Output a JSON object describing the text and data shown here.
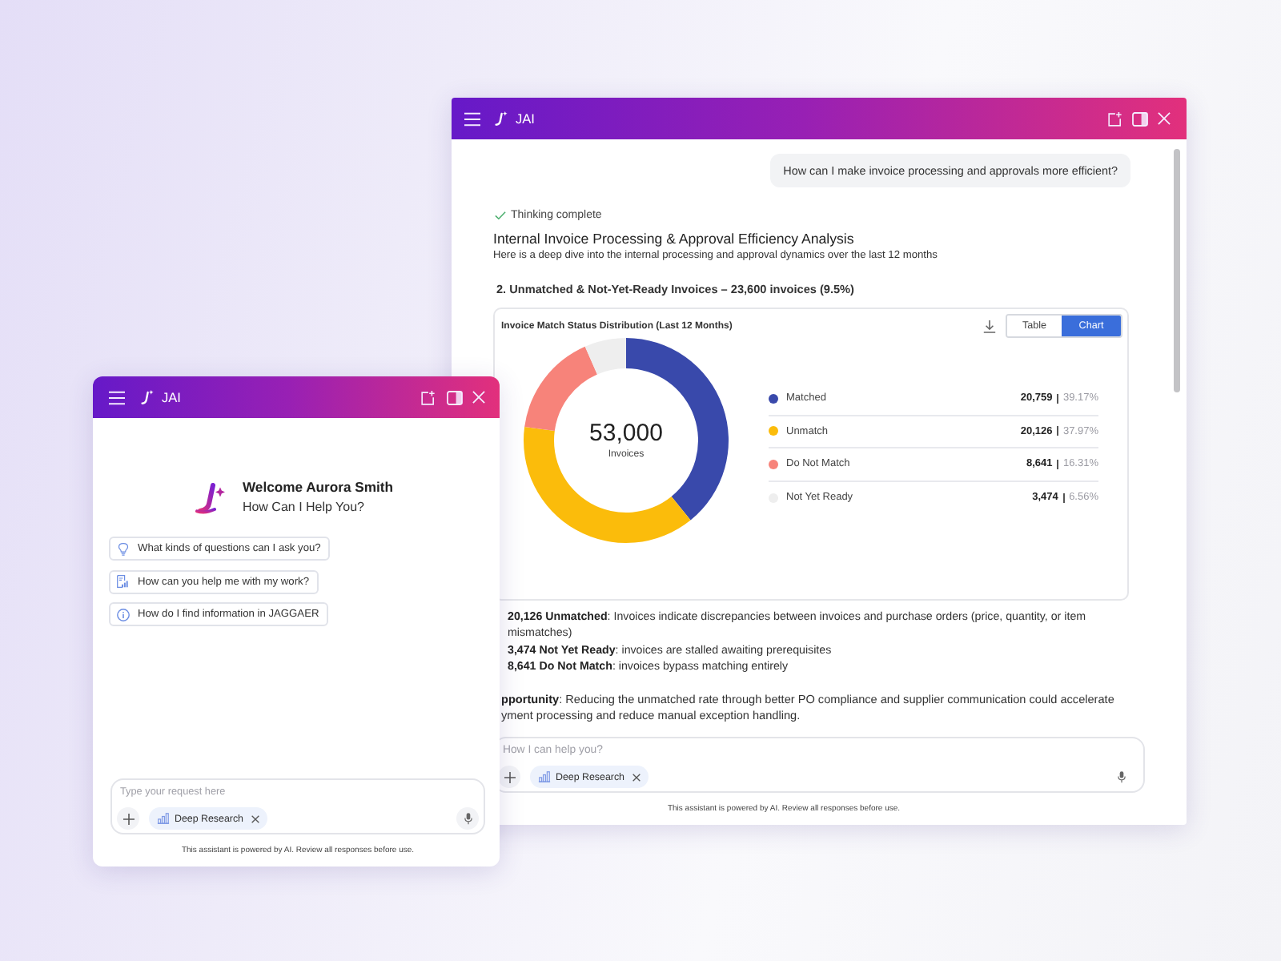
{
  "main_window": {
    "title": "JAI",
    "user_message": "How can I make invoice processing and approvals more efficient?",
    "status": "Thinking complete",
    "heading": "Internal Invoice Processing & Approval Efficiency Analysis",
    "intro": "Here is a deep dive into the internal processing and approval dynamics over the last 12 months",
    "section_title": "2. Unmatched & Not-Yet-Ready Invoices – 23,600 invoices (9.5%)",
    "chart_card": {
      "title": "Invoice Match Status Distribution (Last 12 Months)",
      "view_toggle": [
        {
          "label": "Table",
          "selected": false
        },
        {
          "label": "Chart",
          "selected": true
        }
      ],
      "center_value": "53,000",
      "chart_data": {
        "type": "donut",
        "categories": [
          "Matched",
          "Unmatch",
          "Do Not Match",
          "Not Yet Ready"
        ],
        "series": [
          {
            "name": "Invoices",
            "values": [
              39.17,
              37.97,
              16.31,
              6.56
            ]
          }
        ]
      },
      "legend": [
        {
          "color": "#3949ab",
          "count": "20,759",
          "share": "39.17%"
        },
        {
          "color": "#fbbc0b",
          "count": "20,126",
          "share": "37.97%"
        },
        {
          "color": "#f7837a",
          "count": "8,641",
          "share": "16.31%"
        },
        {
          "color": "#eeeeee",
          "count": "3,474",
          "share": "6.56%"
        }
      ]
    },
    "findings": [
      "**20,126 Unmatched**: Invoices indicate discrepancies between invoices and purchase orders (price, quantity, or item mismatches)",
      "**3,474 Not Yet Ready**: invoices are stalled awaiting prerequisites",
      "**8,641 Do Not Match**: invoices bypass matching entirely"
    ],
    "opportunity_lines": [
      "**pportunity**: Reducing the unmatched rate through better PO compliance and supplier communication could accelerate",
      "yment processing and reduce manual exception handling."
    ],
    "composer": {
      "placeholder": "How I can help you?",
      "chip": "Deep Research"
    },
    "disclaimer": "This assistant is powered by AI. Review all responses before use."
  },
  "mini_window": {
    "title": "JAI",
    "welcome": "Welcome Aurora Smith",
    "prompt": "How Can I Help You?",
    "suggestions": [
      {
        "kind": "idea",
        "text": "What kinds of questions can I ask you?"
      },
      {
        "kind": "work",
        "text": "How can you help me with my work?"
      },
      {
        "kind": "info",
        "text": "How do I find information in JAGGAER"
      }
    ],
    "composer": {
      "placeholder": "Type your request here",
      "chip": "Deep Research"
    },
    "disclaimer": "This assistant is powered by AI. Review all responses before use."
  }
}
